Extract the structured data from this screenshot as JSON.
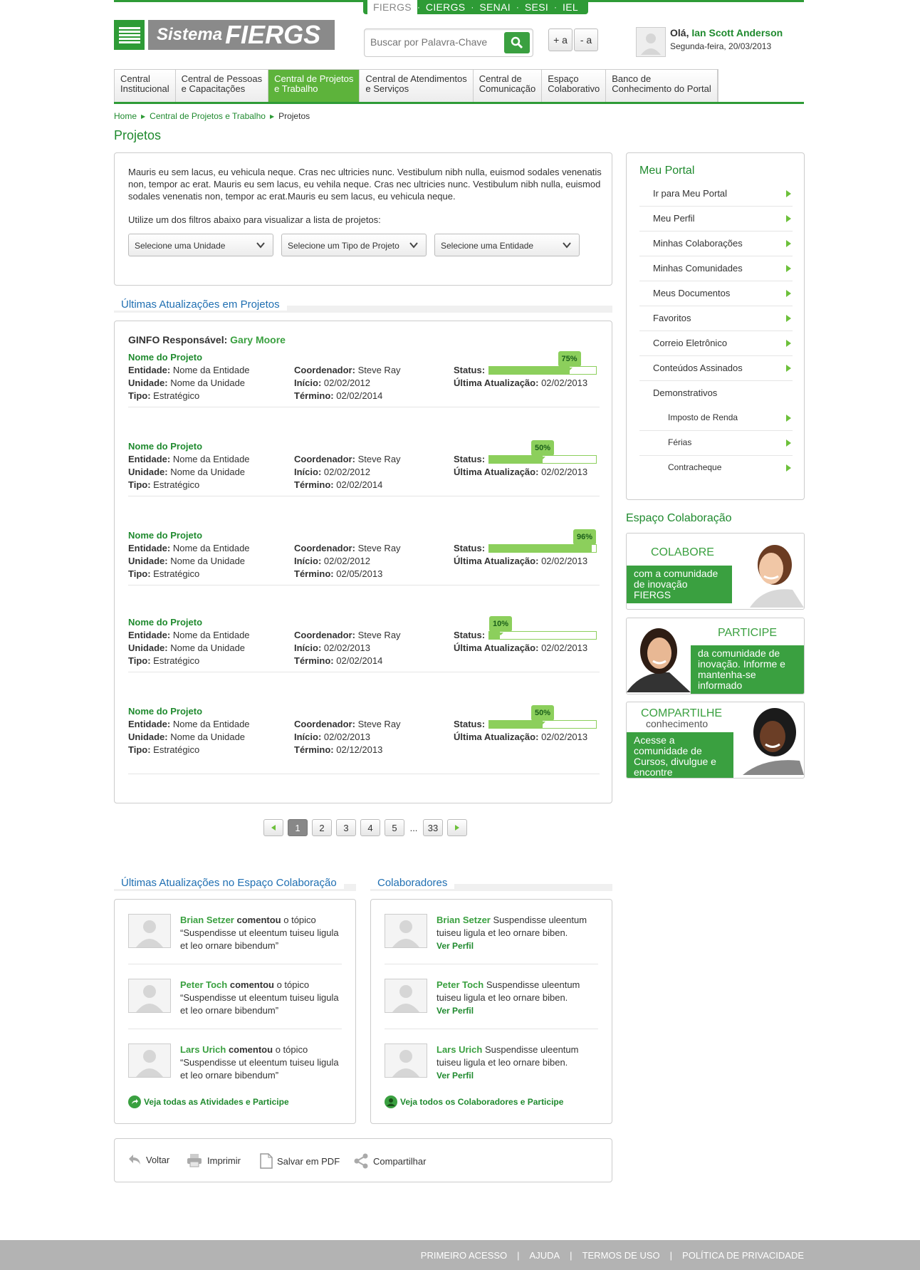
{
  "sysnav": [
    "FIERGS",
    "CIERGS",
    "SENAI",
    "SESI",
    "IEL"
  ],
  "logo": {
    "word1": "Sistema",
    "word2": "FIERGS"
  },
  "search": {
    "placeholder": "Buscar por Palavra-Chave"
  },
  "font_controls": {
    "increase": "+ a",
    "decrease": "- a"
  },
  "user": {
    "greeting": "Olá,",
    "name": "Ian Scott Anderson",
    "date": "Segunda-feira, 20/03/2013"
  },
  "nav": [
    {
      "line1": "Central",
      "line2": "Institucional"
    },
    {
      "line1": "Central de Pessoas",
      "line2": "e Capacitações"
    },
    {
      "line1": "Central de Projetos",
      "line2": "e Trabalho"
    },
    {
      "line1": "Central de Atendimentos",
      "line2": "e Serviços"
    },
    {
      "line1": "Central de",
      "line2": "Comunicação"
    },
    {
      "line1": "Espaço",
      "line2": "Colaborativo"
    },
    {
      "line1": "Banco de",
      "line2": "Conhecimento do Portal"
    }
  ],
  "breadcrumb": {
    "home": "Home",
    "section": "Central de Projetos e Trabalho",
    "current": "Projetos"
  },
  "page_title": "Projetos",
  "intro": {
    "text": "Mauris eu sem lacus, eu vehicula neque. Cras nec ultricies nunc. Vestibulum nibh nulla, euismod sodales venenatis non, tempor ac erat. Mauris eu sem lacus, eu vehila neque. Cras nec ultricies nunc. Vestibulum nibh nulla, euismod sodales venenatis non, tempor ac erat.Mauris eu sem lacus, eu vehicula neque.",
    "filter_hint": "Utilize um dos filtros abaixo para visualizar a lista de projetos:",
    "filters": [
      "Selecione uma Unidade",
      "Selecione um Tipo de Projeto",
      "Selecione uma Entidade"
    ]
  },
  "updates": {
    "title": "Últimas Atualizações em Projetos",
    "ginfo_label": "GINFO Responsável:",
    "ginfo_name": "Gary Moore",
    "labels": {
      "entidade": "Entidade:",
      "unidade": "Unidade:",
      "tipo": "Tipo:",
      "coordenador": "Coordenador:",
      "inicio": "Início:",
      "termino": "Término:",
      "status": "Status:",
      "ultima": "Última Atualização:"
    },
    "projects": [
      {
        "name": "Nome do Projeto",
        "entidade": "Nome da Entidade",
        "unidade": "Nome da Unidade",
        "tipo": "Estratégico",
        "coordenador": "Steve Ray",
        "inicio": "02/02/2012",
        "termino": "02/02/2014",
        "status_label": "75%",
        "status": 0.75,
        "ultima": "02/02/2013"
      },
      {
        "name": "Nome do Projeto",
        "entidade": "Nome da Entidade",
        "unidade": "Nome da Unidade",
        "tipo": "Estratégico",
        "coordenador": "Steve Ray",
        "inicio": "02/02/2012",
        "termino": "02/02/2014",
        "status_label": "50%",
        "status": 0.5,
        "ultima": "02/02/2013"
      },
      {
        "name": "Nome do Projeto",
        "entidade": "Nome da Entidade",
        "unidade": "Nome da Unidade",
        "tipo": "Estratégico",
        "coordenador": "Steve Ray",
        "inicio": "02/02/2012",
        "termino": "02/05/2013",
        "status_label": "96%",
        "status": 0.96,
        "ultima": "02/02/2013"
      },
      {
        "name": "Nome do Projeto",
        "entidade": "Nome da Entidade",
        "unidade": "Nome da Unidade",
        "tipo": "Estratégico",
        "coordenador": "Steve Ray",
        "inicio": "02/02/2013",
        "termino": "02/02/2014",
        "status_label": "10%",
        "status": 0.1,
        "ultima": "02/02/2013"
      },
      {
        "name": "Nome do Projeto",
        "entidade": "Nome da Entidade",
        "unidade": "Nome da Unidade",
        "tipo": "Estratégico",
        "coordenador": "Steve Ray",
        "inicio": "02/02/2013",
        "termino": "02/12/2013",
        "status_label": "50%",
        "status": 0.5,
        "ultima": "02/02/2013"
      }
    ]
  },
  "pagination": {
    "pages": [
      "1",
      "2",
      "3",
      "4",
      "5"
    ],
    "ellipsis": "...",
    "last": "33",
    "current": "1"
  },
  "portal": {
    "title": "Meu Portal",
    "items": [
      "Ir para Meu Portal",
      "Meu Perfil",
      "Minhas Colaborações",
      "Minhas Comunidades",
      "Meus Documentos",
      "Favoritos",
      "Correio Eletrônico",
      "Conteúdos Assinados"
    ],
    "group": "Demonstrativos",
    "subitems": [
      "Imposto de Renda",
      "Férias",
      "Contracheque"
    ]
  },
  "collab": {
    "title": "Espaço Colaboração",
    "b1": {
      "head": "COLABORE",
      "text": "com a comunidade de inovação FIERGS"
    },
    "b2": {
      "head": "PARTICIPE",
      "text": "da comunidade de inovação. Informe e mantenha-se informado"
    },
    "b3": {
      "head": "COMPARTILHE",
      "sub": "conhecimento",
      "text": "Acesse a comunidade de Cursos, divulgue e encontre treinamentos"
    }
  },
  "activity": {
    "title": "Últimas Atualizações no Espaço Colaboração",
    "verb": "comentou",
    "suffix": "o tópico",
    "entries": [
      {
        "name": "Brian Setzer",
        "quote": "“Suspendisse ut eleentum tuiseu ligula et leo ornare bibendum”"
      },
      {
        "name": "Peter Toch",
        "quote": "“Suspendisse ut eleentum tuiseu ligula et leo ornare bibendum”"
      },
      {
        "name": "Lars Urich",
        "quote": "“Suspendisse ut eleentum tuiseu ligula et leo ornare bibendum”"
      }
    ],
    "more": "Veja todas as Atividades e Participe"
  },
  "colaboradores": {
    "title": "Colaboradores",
    "entries": [
      {
        "name": "Brian Setzer",
        "text": "Suspendisse uleentum tuiseu ligula et leo ornare biben."
      },
      {
        "name": "Peter Toch",
        "text": "Suspendisse uleentum tuiseu ligula et leo ornare biben."
      },
      {
        "name": "Lars Urich",
        "text": "Suspendisse uleentum tuiseu ligula et leo ornare biben."
      }
    ],
    "profile_link": "Ver Perfil",
    "more": "Veja todos os Colaboradores e Participe"
  },
  "tools": {
    "back": "Voltar",
    "print": "Imprimir",
    "pdf": "Salvar em PDF",
    "share": "Compartilhar"
  },
  "footer": {
    "links": [
      "PRIMEIRO ACESSO",
      "AJUDA",
      "TERMOS DE USO",
      "POLÍTICA DE PRIVACIDADE"
    ],
    "sep": "|"
  },
  "colors": {
    "brand_green": "#2e9b36",
    "link_green": "#1f8a2e",
    "accent_blue": "#1f6fb2",
    "progress_green": "#8ccf5c"
  }
}
